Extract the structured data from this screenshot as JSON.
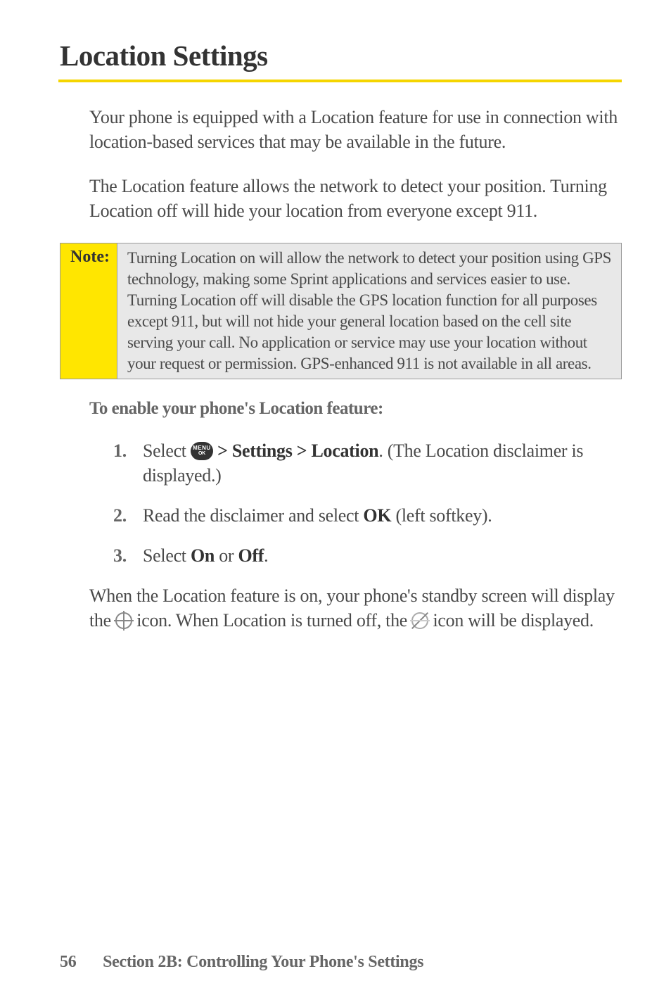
{
  "title": "Location Settings",
  "paragraphs": {
    "p1": "Your phone is equipped with a Location feature for use in connection with location-based services that may be available in the future.",
    "p2": "The Location feature allows the network to detect your position. Turning Location off will hide your location from everyone except 911."
  },
  "note": {
    "label": "Note:",
    "content": "Turning Location on will allow the network to detect your position using GPS technology, making some Sprint applications and services easier to use. Turning Location off will disable the GPS location function for all purposes except 911, but will not hide your general location based on the cell site serving your call. No application or service may use your location without your request or permission. GPS-enhanced 911 is not available in all areas."
  },
  "subheading": "To enable your phone's Location feature:",
  "steps": {
    "s1": {
      "num": "1.",
      "pre": "Select ",
      "boldpath": " > Settings > Location",
      "post": ". (The Location disclaimer is displayed.)"
    },
    "s2": {
      "num": "2.",
      "pre": "Read the disclaimer and select ",
      "bold1": "OK",
      "post": " (left softkey)."
    },
    "s3": {
      "num": "3.",
      "pre": "Select ",
      "bold1": "On",
      "mid": " or ",
      "bold2": "Off",
      "post": "."
    }
  },
  "closing": {
    "pre": "When the Location feature is on, your phone's standby screen will display the ",
    "mid": " icon. When Location is turned off, the ",
    "post": " icon will be displayed."
  },
  "footer": {
    "page": "56",
    "section": "Section 2B: Controlling Your Phone's Settings"
  },
  "icon_labels": {
    "menu_top": "MENU",
    "menu_bot": "OK"
  }
}
